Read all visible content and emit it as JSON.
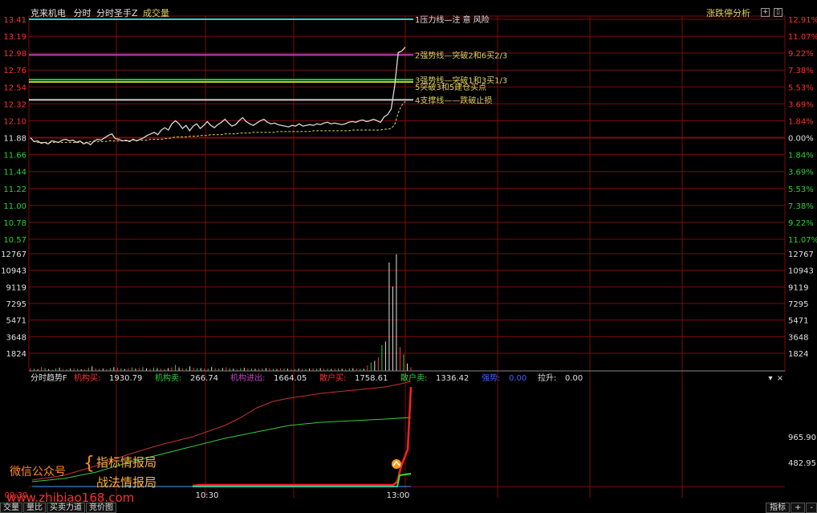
{
  "header": {
    "stock": "克来机电",
    "mode": "分时",
    "indicator": "分时圣手Z",
    "sub": "成交量",
    "right_link": "涨跌停分析"
  },
  "price_axis": {
    "left": [
      "13.41",
      "13.19",
      "12.98",
      "12.76",
      "12.54",
      "12.32",
      "12.10",
      "11.88",
      "11.66",
      "11.44",
      "11.22",
      "11.00",
      "10.78",
      "10.57"
    ],
    "right": [
      "12.91%",
      "11.07%",
      "9.22%",
      "7.38%",
      "5.53%",
      "3.69%",
      "1.84%",
      "0.00%",
      "1.84%",
      "3.69%",
      "5.53%",
      "7.38%",
      "9.22%",
      "11.07%"
    ],
    "pre_close": 11.88,
    "pmin": 10.57,
    "pmax": 13.41
  },
  "volume_axis": {
    "labels": [
      "12767",
      "10943",
      "9119",
      "7295",
      "5471",
      "3648",
      "1824"
    ],
    "vmax": 12767
  },
  "levels": [
    {
      "price": 13.41,
      "color": "#2fd0d0",
      "label": "1压力线—注 意 风险",
      "lcolor": "#e0e0e0"
    },
    {
      "price": 12.95,
      "color": "#c040c0",
      "label": "2强势线—突破2和6买2/3",
      "lcolor": "#e0d060"
    },
    {
      "price": 12.63,
      "color": "#30d030",
      "label": "3强势线—突破1和3买1/3",
      "lcolor": "#e0d060"
    },
    {
      "price": 12.6,
      "color": "#d0d030",
      "label": "5突破3和5建仓买点",
      "lcolor": "#e0d060"
    },
    {
      "price": 12.37,
      "color": "#d0d0d0",
      "label": "4支撑线——跌破止损",
      "lcolor": "#e0d060"
    }
  ],
  "chart_data": [
    {
      "type": "line",
      "title": "",
      "series": [
        {
          "values": [
            11.88,
            11.83,
            11.84,
            11.81,
            11.82,
            11.8,
            11.84,
            11.83,
            11.82,
            11.85,
            11.86,
            11.84,
            11.85,
            11.82,
            11.84,
            11.8,
            11.82,
            11.79,
            11.84,
            11.86,
            11.85,
            11.88,
            11.91,
            11.93,
            11.87,
            11.86,
            11.84,
            11.85,
            11.83,
            11.86,
            11.84,
            11.86,
            11.88,
            11.91,
            11.93,
            11.95,
            11.92,
            11.98,
            12.01,
            11.98,
            12.06,
            12.1,
            12.06,
            12.0,
            12.04,
            11.97,
            12.03,
            12.06,
            12.0,
            12.04,
            12.09,
            12.04,
            12.01,
            12.05,
            12.08,
            12.12,
            12.07,
            12.03,
            12.05,
            12.1,
            12.14,
            12.09,
            12.06,
            12.04,
            12.07,
            12.1,
            12.12,
            12.08,
            12.06,
            12.07,
            12.05,
            12.04,
            12.03,
            12.02,
            12.04,
            12.03,
            12.06,
            12.03,
            12.04,
            12.05,
            12.04,
            12.06,
            12.05,
            12.07,
            12.08,
            12.06,
            12.07,
            12.06,
            12.05,
            12.06,
            12.08,
            12.09,
            12.08,
            12.1,
            12.11,
            12.09,
            12.1,
            12.12,
            12.1,
            12.08,
            12.15,
            12.18,
            12.25,
            12.55,
            12.98,
            13.0,
            13.05
          ]
        },
        {
          "values": [
            11.88,
            11.83,
            11.82,
            11.82,
            11.82,
            11.82,
            11.82,
            11.82,
            11.82,
            11.82,
            11.82,
            11.82,
            11.82,
            11.82,
            11.82,
            11.82,
            11.82,
            11.83,
            11.83,
            11.83,
            11.83,
            11.83,
            11.84,
            11.84,
            11.84,
            11.84,
            11.84,
            11.84,
            11.84,
            11.85,
            11.85,
            11.85,
            11.85,
            11.85,
            11.86,
            11.86,
            11.86,
            11.86,
            11.87,
            11.87,
            11.88,
            11.89,
            11.89,
            11.89,
            11.89,
            11.9,
            11.9,
            11.9,
            11.91,
            11.91,
            11.91,
            11.92,
            11.92,
            11.92,
            11.92,
            11.93,
            11.93,
            11.93,
            11.93,
            11.94,
            11.94,
            11.94,
            11.94,
            11.95,
            11.95,
            11.95,
            11.95,
            11.95,
            11.95,
            11.95,
            11.96,
            11.96,
            11.96,
            11.96,
            11.96,
            11.96,
            11.96,
            11.96,
            11.96,
            11.96,
            11.97,
            11.97,
            11.97,
            11.97,
            11.97,
            11.97,
            11.97,
            11.97,
            11.97,
            11.97,
            11.97,
            11.98,
            11.98,
            11.98,
            11.98,
            11.98,
            11.98,
            11.98,
            11.98,
            11.98,
            11.99,
            11.99,
            12.0,
            12.05,
            12.2,
            12.3,
            12.35
          ]
        }
      ]
    },
    {
      "type": "bar",
      "title": "",
      "values": [
        300,
        250,
        180,
        420,
        320,
        200,
        150,
        280,
        350,
        220,
        180,
        260,
        300,
        240,
        190,
        210,
        340,
        500,
        280,
        220,
        260,
        180,
        300,
        410,
        350,
        280,
        220,
        300,
        380,
        260,
        310,
        420,
        280,
        240,
        360,
        300,
        260,
        220,
        300,
        400,
        650,
        380,
        300,
        260,
        500,
        340,
        280,
        300,
        260,
        240,
        420,
        300,
        260,
        320,
        380,
        300,
        260,
        220,
        300,
        340,
        280,
        260,
        240,
        220,
        260,
        300,
        280,
        240,
        220,
        300,
        260,
        240,
        220,
        200,
        260,
        240,
        220,
        260,
        280,
        240,
        300,
        260,
        240,
        220,
        260,
        280,
        240,
        220,
        260,
        300,
        280,
        260,
        240,
        600,
        900,
        1100,
        1500,
        2800,
        3200,
        11800,
        9200,
        12700,
        2600,
        1800,
        800,
        400
      ],
      "ylim": [
        0,
        12767
      ]
    }
  ],
  "indicator_panel": {
    "name": "分时趋势F",
    "items": [
      {
        "label": "机构买:",
        "value": "1930.79",
        "color": "#ff3030"
      },
      {
        "label": "机构卖:",
        "value": "266.74",
        "color": "#30d030"
      },
      {
        "label": "机构进出:",
        "value": "1664.05",
        "color": "#c040c0"
      },
      {
        "label": "散户买:",
        "value": "1758.61",
        "color": "#ff3030"
      },
      {
        "label": "散户卖:",
        "value": "1336.42",
        "color": "#30d030"
      },
      {
        "label": "强势:",
        "value": "0.00",
        "color": "#4060ff"
      },
      {
        "label": "拉升:",
        "value": "0.00",
        "color": "#e0e0e0"
      }
    ],
    "right_labels": [
      "965.90",
      "482.95"
    ],
    "time_labels": [
      "09:30",
      "10:30",
      "13:00"
    ]
  },
  "watermark": {
    "line1_prefix": "微信公众号",
    "line1": "指标情报局",
    "line2": "战法情报局",
    "url": "www.zhibiao168.com"
  },
  "tabs": [
    "交量",
    "量比",
    "买卖力道",
    "竞价图"
  ],
  "right_tabs": [
    "指标",
    "+",
    "-"
  ],
  "colors": {
    "grid": "#7a0d0d",
    "up": "#ff3030",
    "down": "#30d030",
    "price": "#d8d8d8"
  }
}
